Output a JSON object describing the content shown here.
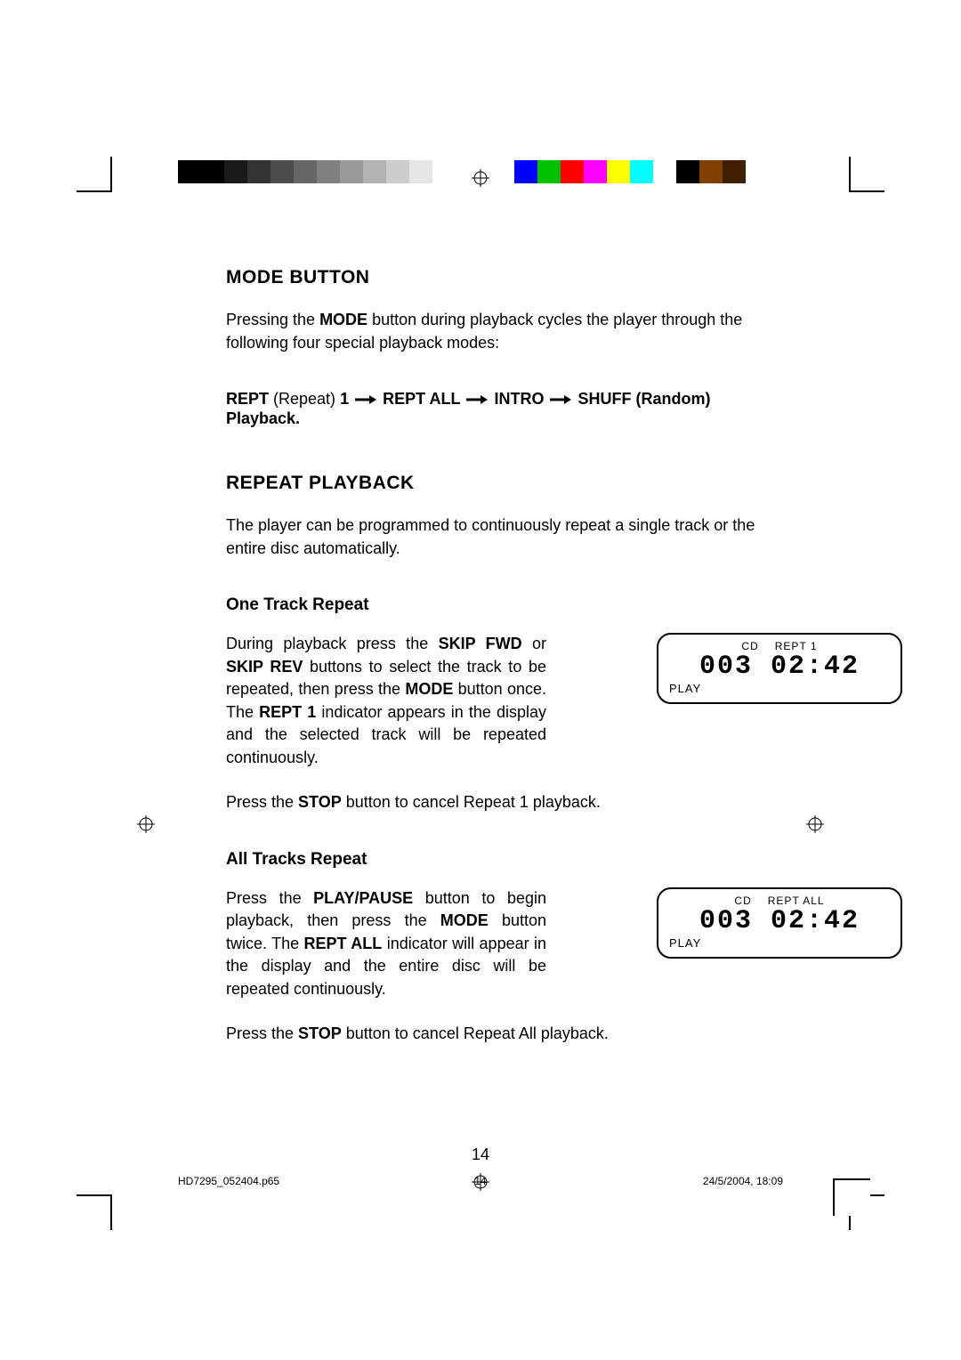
{
  "headings": {
    "mode_button": "MODE BUTTON",
    "repeat_playback": "REPEAT PLAYBACK",
    "one_track": "One Track Repeat",
    "all_tracks": "All Tracks Repeat"
  },
  "mode_intro": {
    "pre": "Pressing the ",
    "btn": "MODE",
    "post": " button during playback cycles the player through the following four special playback modes:"
  },
  "cycle": {
    "rept": "REPT",
    "repeat_paren": " (Repeat) ",
    "one": "1",
    "rept_all": "REPT ALL",
    "intro": "INTRO",
    "shuff": "SHUFF (Random) Playback."
  },
  "repeat_intro": "The player can be programmed to continuously repeat a single track or the entire disc automatically.",
  "one_track_para": {
    "p1a": "During playback press the ",
    "skip_fwd": "SKIP FWD",
    "or": " or ",
    "skip_rev": "SKIP REV",
    "p1b": " buttons to select the track to be repeated, then press the ",
    "mode": "MODE",
    "p1c": " button once. The ",
    "rept1": "REPT 1",
    "p1d": " indicator appears in the display and the selected track will be repeated continuously.",
    "p2a": "Press the ",
    "stop": "STOP",
    "p2b": " button to cancel Repeat 1 playback."
  },
  "all_tracks_para": {
    "p1a": "Press the ",
    "play_pause": "PLAY/PAUSE",
    "p1b": " button to begin playback, then press the ",
    "mode": "MODE",
    "p1c": " button twice. The ",
    "rept_all": "REPT ALL",
    "p1d": " indicator will appear in the display and the entire disc will be repeated continuously.",
    "p2a": "Press the ",
    "stop": "STOP",
    "p2b": " button to cancel Repeat All playback."
  },
  "lcd1": {
    "top_cd": "CD",
    "top_mode": "REPT 1",
    "seg": "003 02:42",
    "play": "PLAY"
  },
  "lcd2": {
    "top_cd": "CD",
    "top_mode": "REPT  ALL",
    "seg": "003 02:42",
    "play": "PLAY"
  },
  "page_number": "14",
  "footer": {
    "file": "HD7295_052404.p65",
    "page": "14",
    "date": "24/5/2004, 18:09"
  },
  "color_bar": {
    "grey": [
      "#000000",
      "#000000",
      "#1a1a1a",
      "#333333",
      "#4d4d4d",
      "#666666",
      "#808080",
      "#999999",
      "#b3b3b3",
      "#cccccc",
      "#e6e6e6",
      "#ffffff"
    ],
    "colors": [
      "#0000ff",
      "#00c000",
      "#ff0000",
      "#ff00ff",
      "#ffff00",
      "#00ffff",
      "#ffffff",
      "#000000",
      "#804000",
      "#402000"
    ]
  }
}
